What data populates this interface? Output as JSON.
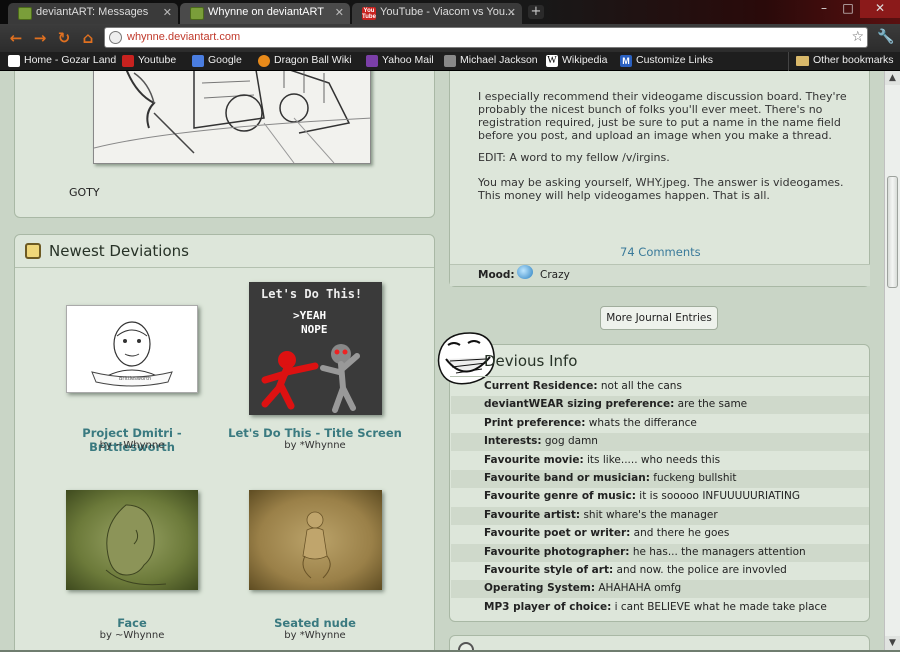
{
  "browser": {
    "tabs": [
      {
        "title": "deviantART: Messages",
        "active": false,
        "favicon": "deviantart-icon"
      },
      {
        "title": "Whynne on deviantART",
        "active": true,
        "favicon": "deviantart-icon"
      },
      {
        "title": "YouTube - Viacom vs You...",
        "active": false,
        "favicon": "youtube-icon"
      }
    ],
    "new_tab_label": "+",
    "url": "whynne.deviantart.com",
    "window_controls": {
      "minimize": "–",
      "maximize": "□",
      "close": "✕"
    },
    "bookmarks": [
      {
        "label": "Home - Gozar Land",
        "icon_color": "#ffffff"
      },
      {
        "label": "Youtube",
        "icon_color": "#c8221f"
      },
      {
        "label": "Google",
        "icon_color": "#4a7de0"
      },
      {
        "label": "Dragon Ball Wiki",
        "icon_color": "#e88a1a"
      },
      {
        "label": "Yahoo Mail",
        "icon_color": "#7b3fa8"
      },
      {
        "label": "Michael Jackson",
        "icon_color": "#888888"
      },
      {
        "label": "Wikipedia",
        "icon_color": "#ffffff"
      },
      {
        "label": "Customize Links",
        "icon_color": "#2a60c0"
      }
    ],
    "other_bookmarks": "Other bookmarks"
  },
  "journal": {
    "paragraphs": [
      "I especially recommend their videogame discussion board. They're probably the nicest bunch of folks you'll ever meet. There's no registration required, just be sure to put a name in the name field before you post, and upload an image when you make a thread.",
      "EDIT: A word to my fellow /v/irgins.",
      "You may be asking yourself, WHY.jpeg. The answer is videogames. This money will help videogames happen. That is all."
    ],
    "comments": "74 Comments",
    "mood_label": "Mood:",
    "mood_value": "Crazy",
    "more_button": "More Journal Entries"
  },
  "featured": {
    "caption": "GOTY"
  },
  "newest": {
    "title": "Newest Deviations",
    "items": [
      {
        "title": "Project Dmitri - Brittlesworth",
        "by": "by ~Whynne"
      },
      {
        "title": "Let's Do This - Title Screen",
        "by": "by *Whynne"
      },
      {
        "title": "Face",
        "by": "by ~Whynne"
      },
      {
        "title": "Seated nude",
        "by": "by *Whynne"
      }
    ],
    "game_screen": {
      "heading": "Let's Do This!",
      "opt1": ">YEAH",
      "opt2": "NOPE"
    },
    "scroll_caption": "Brittlesworth"
  },
  "devious_info": {
    "title": "Devious Info",
    "rows": [
      {
        "label": "Current Residence:",
        "value": "not all the cans"
      },
      {
        "label": "deviantWEAR sizing preference:",
        "value": "are the same"
      },
      {
        "label": "Print preference:",
        "value": "whats the differance"
      },
      {
        "label": "Interests:",
        "value": "gog damn"
      },
      {
        "label": "Favourite movie:",
        "value": "its like..... who needs this"
      },
      {
        "label": "Favourite band or musician:",
        "value": "fuckeng bullshit"
      },
      {
        "label": "Favourite genre of music:",
        "value": "it is sooooo INFUUUUURIATING"
      },
      {
        "label": "Favourite artist:",
        "value": "shit whare's the manager"
      },
      {
        "label": "Favourite poet or writer:",
        "value": "and there he goes"
      },
      {
        "label": "Favourite photographer:",
        "value": "he has... the managers attention"
      },
      {
        "label": "Favourite style of art:",
        "value": "and now. the police are invovled"
      },
      {
        "label": "Operating System:",
        "value": "AHAHAHA omfg"
      },
      {
        "label": "MP3 player of choice:",
        "value": "i cant BELIEVE what he made take place"
      }
    ]
  },
  "scroll": {
    "up": "▲",
    "down": "▼"
  }
}
